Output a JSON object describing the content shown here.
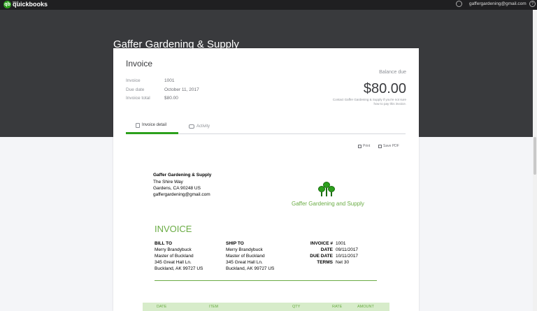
{
  "topbar": {
    "logo_small": "intuit",
    "logo_main": "quickbooks",
    "user_email": "gaffergardening@gmail.com",
    "help_symbol": "?"
  },
  "company_name": "Gaffer Gardening & Supply",
  "invoice_card": {
    "heading": "Invoice",
    "meta": [
      {
        "label": "Invoice",
        "value": "1001"
      },
      {
        "label": "Due date",
        "value": "October 11, 2017"
      },
      {
        "label": "Invoice total",
        "value": "$80.00"
      }
    ],
    "balance_label": "Balance due",
    "balance_amount": "$80.00",
    "contact_note": "Contact Gaffer Gardening & Supply if you're not sure how to pay this invoice.",
    "tabs": [
      {
        "label": "Invoice detail",
        "active": true
      },
      {
        "label": "Activity",
        "active": false
      }
    ],
    "actions": {
      "print": "Print",
      "save_pdf": "Save PDF"
    }
  },
  "document": {
    "business": {
      "name": "Gaffer Gardening & Supply",
      "lines": [
        "The Shire Way",
        "Gardens, CA  90248 US",
        "gaffergardening@gmail.com"
      ]
    },
    "logo_name": "Gaffer Gardening and Supply",
    "title": "INVOICE",
    "bill_to": {
      "heading": "BILL TO",
      "lines": [
        "Merry Brandybuck",
        "Master of Buckland",
        "345 Great Hall Ln.",
        "Buckland, AK  99727 US"
      ]
    },
    "ship_to": {
      "heading": "SHIP TO",
      "lines": [
        "Merry Brandybuck",
        "Master of Buckland",
        "345 Great Hall Ln.",
        "Buckland, AK  99727 US"
      ]
    },
    "details": [
      {
        "key": "INVOICE #",
        "value": "1001"
      },
      {
        "key": "DATE",
        "value": "09/11/2017"
      },
      {
        "key": "DUE DATE",
        "value": "10/11/2017"
      },
      {
        "key": "TERMS",
        "value": "Net 30"
      }
    ],
    "table_headers": [
      "DATE",
      "ITEM",
      "QTY",
      "RATE",
      "AMOUNT"
    ]
  },
  "colors": {
    "brand_green": "#2ca01c",
    "doc_green": "#6aac44",
    "header_dark": "#393a3d",
    "topbar_dark": "#1f1f21"
  }
}
